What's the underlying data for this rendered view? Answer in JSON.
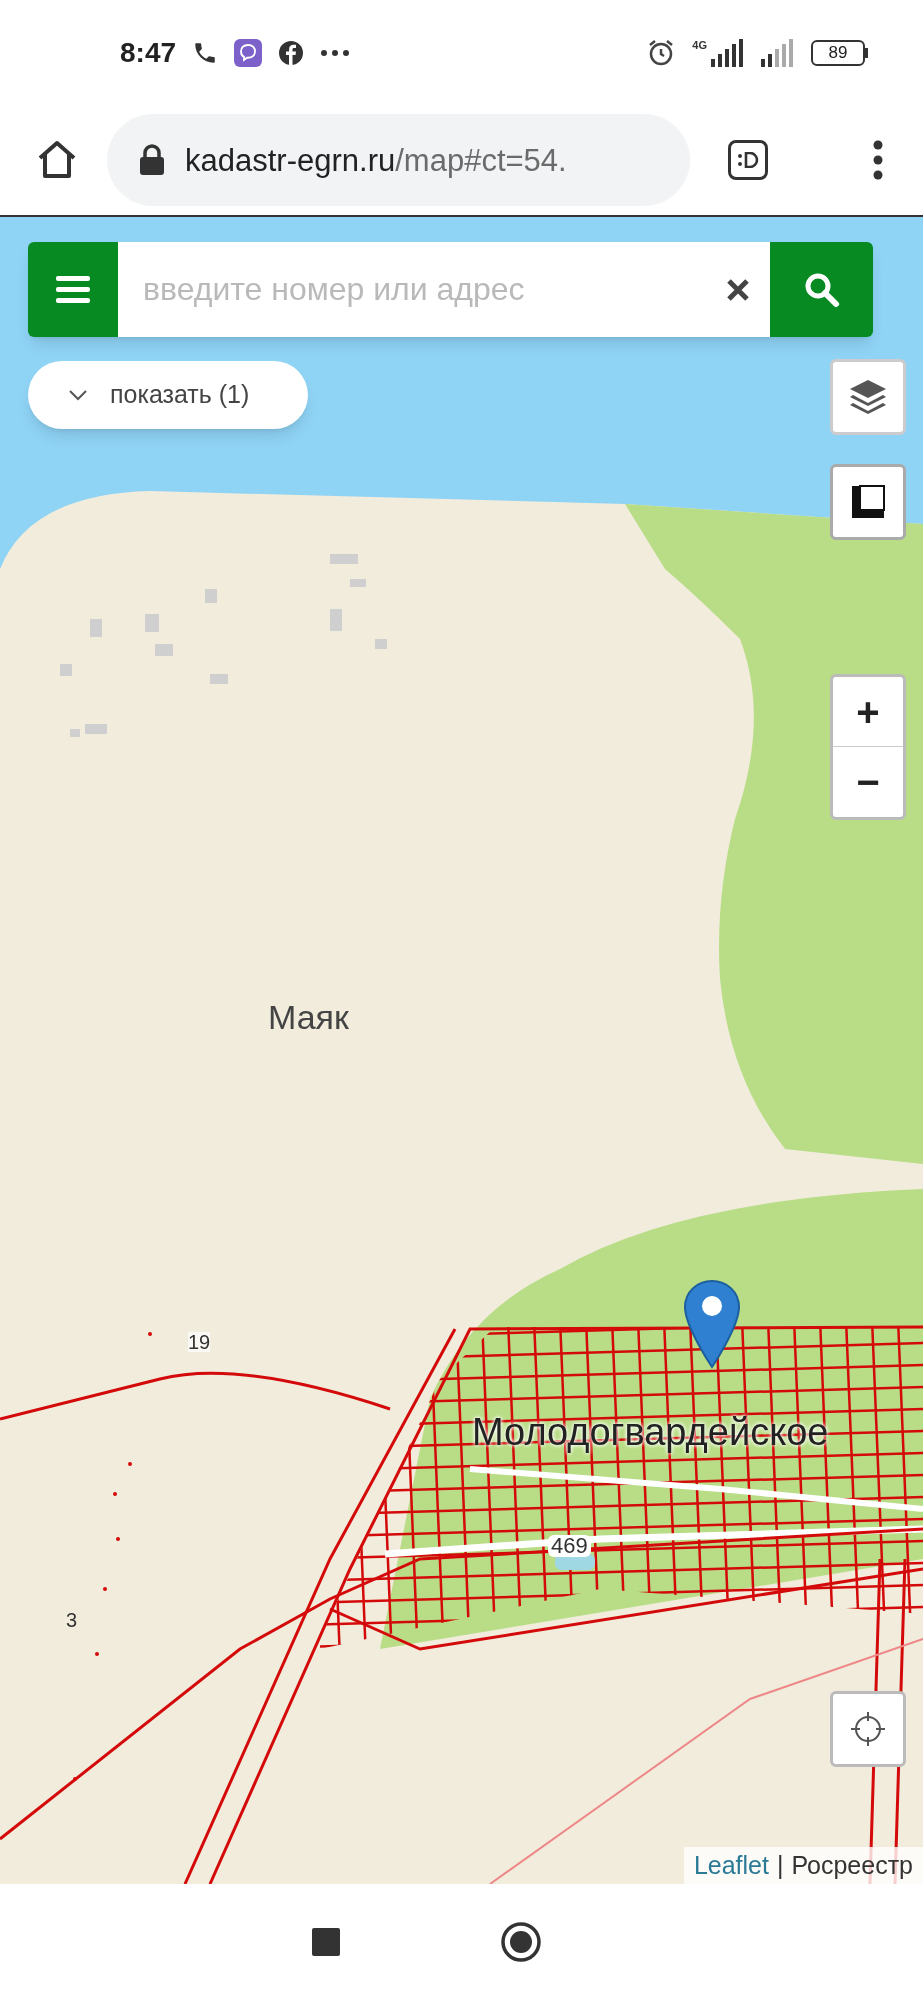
{
  "status_bar": {
    "time": "8:47",
    "network": "4G",
    "battery": "89"
  },
  "browser": {
    "url_host": "kadastr-egrn.ru",
    "url_path": "/map#ct=54."
  },
  "search": {
    "placeholder": "введите номер или адрес"
  },
  "show_button": {
    "label": "показать (1)"
  },
  "zoom": {
    "in": "+",
    "out": "−"
  },
  "map_labels": [
    {
      "kind": "place",
      "text": "Маяк"
    },
    {
      "kind": "place",
      "text": "Молодогвардейское"
    },
    {
      "kind": "road",
      "text": "469"
    },
    {
      "kind": "number",
      "text": "19"
    },
    {
      "kind": "number",
      "text": "3"
    }
  ],
  "attribution": {
    "link": "Leaflet",
    "separator": "|",
    "source": "Росреестр"
  }
}
